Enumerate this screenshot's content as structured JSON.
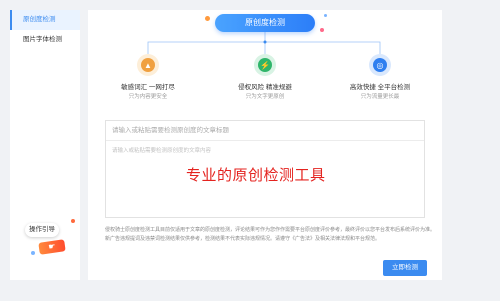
{
  "sidebar": {
    "items": [
      {
        "label": "原创度检测",
        "active": true
      },
      {
        "label": "图片字体检测",
        "active": false
      }
    ]
  },
  "guide": {
    "label": "操作引导"
  },
  "header": {
    "title": "原创度检测"
  },
  "features": [
    {
      "title": "敏感词汇 一网打尽",
      "subtitle": "只为内容更安全",
      "icon": "warning-sign-icon",
      "color": "#f0a040"
    },
    {
      "title": "侵权风险 精准规避",
      "subtitle": "只为文字更原创",
      "icon": "lightning-shield-icon",
      "color": "#2fb56a"
    },
    {
      "title": "高效快捷 全平台检测",
      "subtitle": "只为流量更长最",
      "icon": "globe-icon",
      "color": "#2f7ff0"
    }
  ],
  "editor": {
    "title_placeholder": "请输入或粘贴需要检测原创度的文章标题",
    "body_placeholder": "请输入或粘贴需要检测原创度的文章内容",
    "watermark": "专业的原创检测工具"
  },
  "notice": {
    "line1": "侵权骑士原创度检测工具目前仅适用于文章的原创度检测，评论结果可作为您作作需要平台原创度评价参考，最终评价以您平台发布后系统评价为准。",
    "line2": "新广告违规提词及违禁词检测结果仅供参考，检测结果不代表实际违规情况。请遵守《广告法》及相关法律法规和平台规范。"
  },
  "actions": {
    "submit_label": "立即检测"
  },
  "colors": {
    "accent": "#3b8bf0",
    "watermark": "#e4231f"
  }
}
